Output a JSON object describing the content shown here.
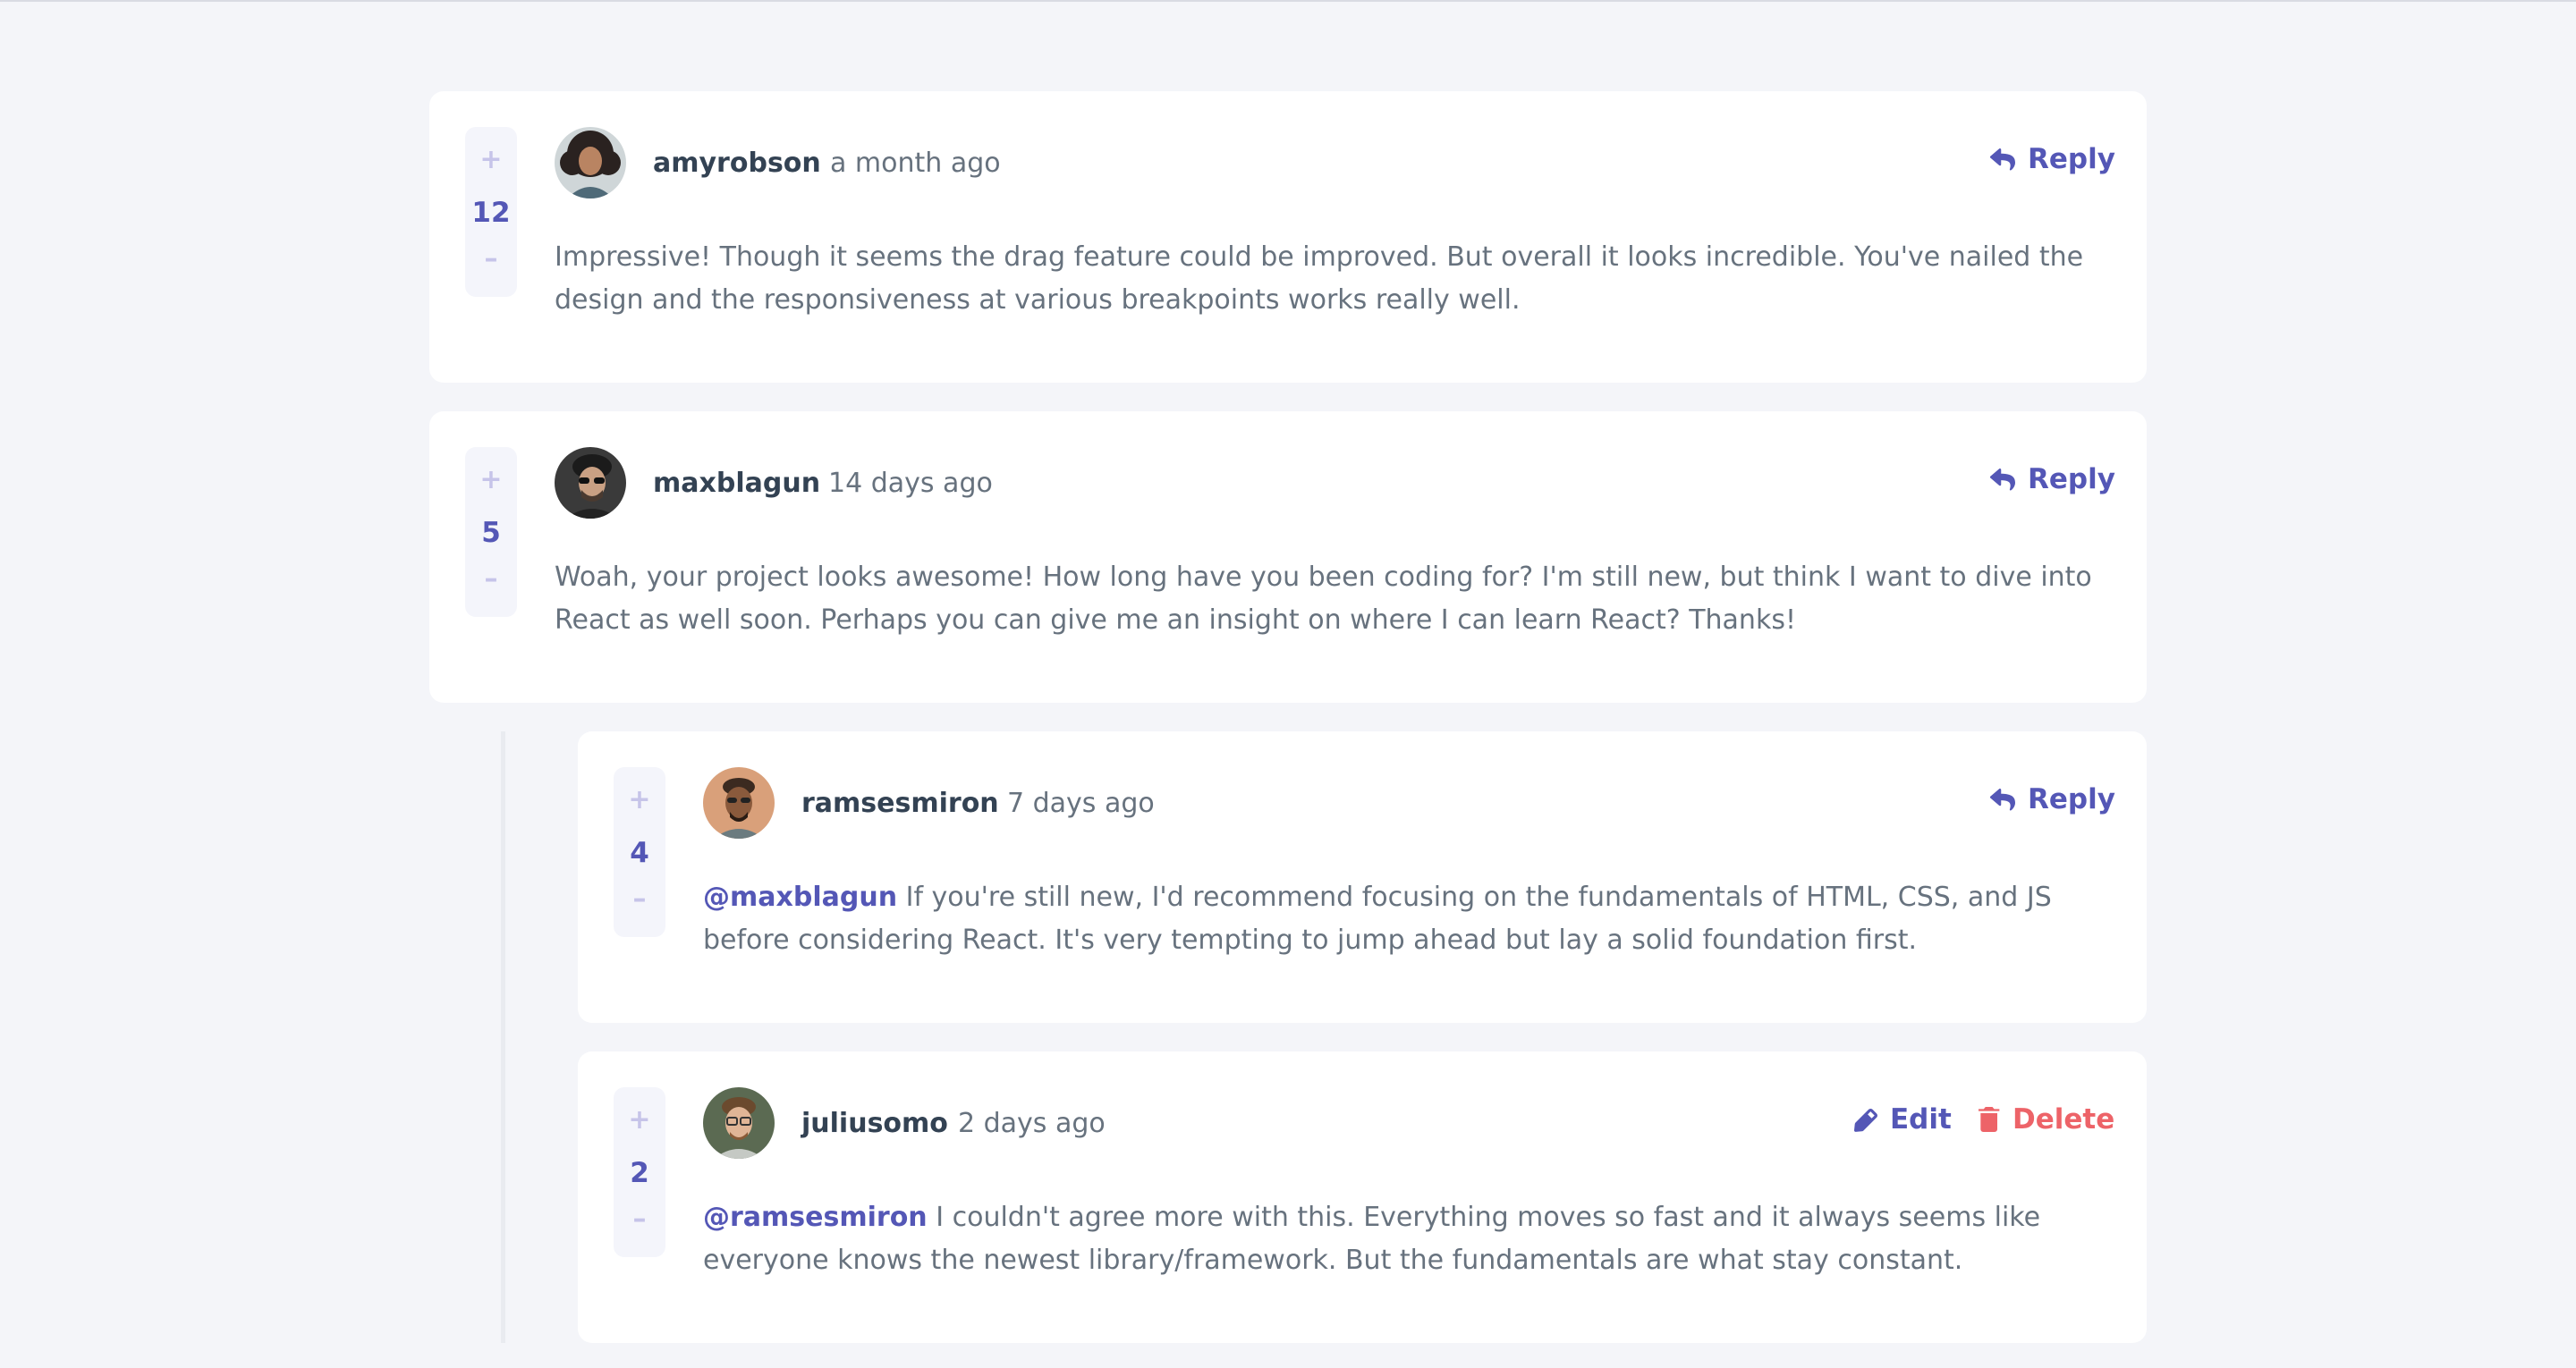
{
  "action_labels": {
    "reply": "Reply",
    "edit": "Edit",
    "delete": "Delete"
  },
  "colors": {
    "accent": "#5457b6",
    "danger": "#ed6368",
    "text": "#67727e",
    "name": "#334253",
    "background": "#f4f5f9"
  },
  "comments": [
    {
      "score": "12",
      "username": "amyrobson",
      "created": "a month ago",
      "content": "Impressive! Though it seems the drag feature could be improved. But overall it looks incredible. You've nailed the design and the responsiveness at various breakpoints works really well."
    },
    {
      "score": "5",
      "username": "maxblagun",
      "created": "14 days ago",
      "content": "Woah, your project looks awesome! How long have you been coding for? I'm still new, but think I want to dive into React as well soon. Perhaps you can give me an insight on where I can learn React? Thanks!"
    }
  ],
  "replies": [
    {
      "score": "4",
      "username": "ramsesmiron",
      "created": "7 days ago",
      "mention": "@maxblagun",
      "content": "If you're still new, I'd recommend focusing on the fundamentals of HTML, CSS, and JS before considering React. It's very tempting to jump ahead but lay a solid foundation first."
    },
    {
      "score": "2",
      "username": "juliusomo",
      "created": "2 days ago",
      "mention": "@ramsesmiron",
      "content": "I couldn't agree more with this. Everything moves so fast and it always seems like everyone knows the newest library/framework. But the fundamentals are what stay constant."
    }
  ]
}
